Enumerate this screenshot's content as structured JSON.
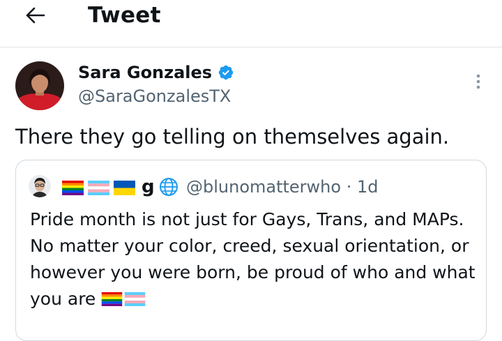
{
  "header": {
    "title": "Tweet",
    "back_icon": "back-arrow-icon"
  },
  "tweet": {
    "author_name": "Sara Gonzales",
    "author_handle": "@SaraGonzalesTX",
    "verified_icon": "verified-badge-icon",
    "text": "There they go telling on themselves again.",
    "more_icon": "more-options-icon"
  },
  "quote": {
    "display_name_letter": "g",
    "flags": [
      "rainbow-flag-icon",
      "transgender-flag-icon",
      "ukraine-flag-icon"
    ],
    "globe_icon": "globe-icon",
    "handle": "@blunomatterwho",
    "time": "· 1d",
    "text": "Pride month is not just for Gays, Trans, and MAPs. No matter your color, creed, sexual orientation, or however you were born, be proud of who and what you are"
  },
  "colors": {
    "brand_blue": "#1d9bf0",
    "text": "#0f1419",
    "secondary": "#536471",
    "border": "#cfd9de"
  }
}
